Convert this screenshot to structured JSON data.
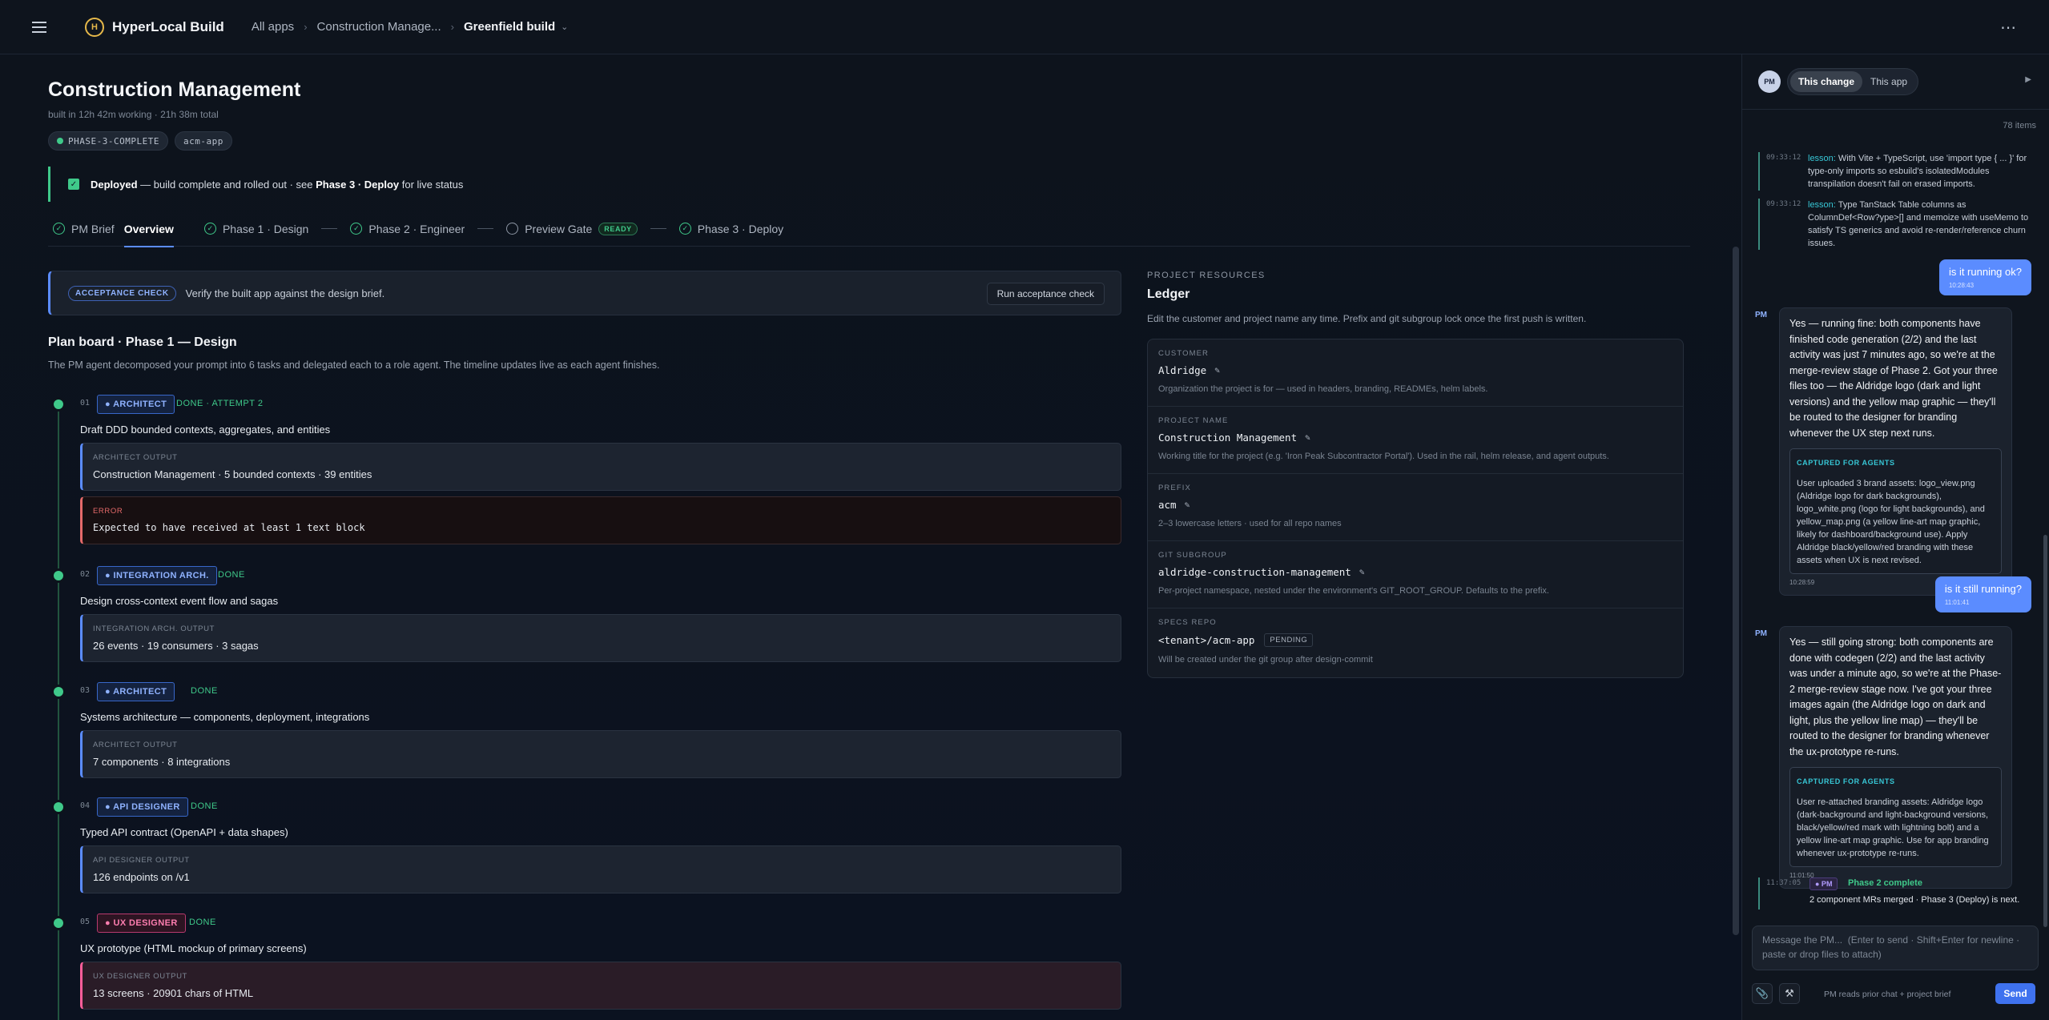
{
  "topbar": {
    "brand": "HyperLocal Build",
    "logo_letter": "H",
    "crumbs": [
      "All apps",
      "Construction Manage...",
      "Greenfield build"
    ],
    "caret": "⌄",
    "more": "⋯"
  },
  "header": {
    "title": "Construction Management",
    "subtitle": "built in 12h 42m working · 21h 38m total",
    "chips": [
      "PHASE-3-COMPLETE",
      "acm-app"
    ]
  },
  "deploy": {
    "strong": "Deployed",
    "text": " — build complete and rolled out · see ",
    "link": "Phase 3 · Deploy",
    "tail": " for live status"
  },
  "tabs": {
    "pm_brief": "PM Brief",
    "overview": "Overview",
    "phase1": "Phase 1 · Design",
    "phase2": "Phase 2 · Engineer",
    "preview": "Preview Gate",
    "ready": "READY",
    "phase3": "Phase 3 · Deploy"
  },
  "acceptance": {
    "tag": "ACCEPTANCE CHECK",
    "text": "Verify the built app against the design brief.",
    "button": "Run acceptance check"
  },
  "plan": {
    "title": "Plan board · Phase 1 — Design",
    "desc": "The PM agent decomposed your prompt into 6 tasks and delegated each to a role agent. The timeline updates live as each agent finishes.",
    "tasks": [
      {
        "num": "01",
        "role": "● ARCHITECT",
        "status": "DONE · ATTEMPT 2",
        "title": "Draft DDD bounded contexts, aggregates, and entities",
        "out_label": "ARCHITECT OUTPUT",
        "out_value": "Construction Management · 5 bounded contexts · 39 entities",
        "err_label": "ERROR",
        "err_value": "Expected to have received at least 1 text block"
      },
      {
        "num": "02",
        "role": "● INTEGRATION ARCH.",
        "status": "DONE",
        "title": "Design cross-context event flow and sagas",
        "out_label": "INTEGRATION ARCH. OUTPUT",
        "out_value": "26 events · 19 consumers · 3 sagas"
      },
      {
        "num": "03",
        "role": "● ARCHITECT",
        "status": "DONE",
        "title": "Systems architecture — components, deployment, integrations",
        "out_label": "ARCHITECT OUTPUT",
        "out_value": "7 components · 8 integrations"
      },
      {
        "num": "04",
        "role": "● API DESIGNER",
        "status": "DONE",
        "title": "Typed API contract (OpenAPI + data shapes)",
        "out_label": "API DESIGNER OUTPUT",
        "out_value": "126 endpoints on /v1"
      },
      {
        "num": "05",
        "role": "● UX DESIGNER",
        "status": "DONE",
        "title": "UX prototype (HTML mockup of primary screens)",
        "out_label": "UX DESIGNER OUTPUT",
        "out_value": "13 screens · 20901 chars of HTML"
      }
    ]
  },
  "resources": {
    "head": "PROJECT RESOURCES",
    "title": "Ledger",
    "desc": "Edit the customer and project name any time. Prefix and git subgroup lock once the first push is written.",
    "pencil": "✎",
    "rows": [
      {
        "label": "CUSTOMER",
        "value": "Aldridge",
        "help": "Organization the project is for — used in headers, branding, READMEs, helm labels."
      },
      {
        "label": "PROJECT NAME",
        "value": "Construction Management",
        "help": "Working title for the project (e.g. 'Iron Peak Subcontractor Portal'). Used in the rail, helm release, and agent outputs."
      },
      {
        "label": "PREFIX",
        "value": "acm",
        "help": "2–3 lowercase letters · used for all repo names"
      },
      {
        "label": "GIT SUBGROUP",
        "value": "aldridge-construction-management",
        "help": "Per-project namespace, nested under the environment's GIT_ROOT_GROUP. Defaults to the prefix."
      },
      {
        "label": "SPECS REPO",
        "value": "<tenant>/acm-app",
        "badge": "PENDING",
        "help": "Will be created under the git group after design-commit"
      }
    ]
  },
  "chat": {
    "avatar": "PM",
    "seg": [
      "This change",
      "This app"
    ],
    "collapse": "▶",
    "count": "78 items",
    "lessons": [
      {
        "time": "09:33:12",
        "key": "lesson:",
        "text": " With Vite + TypeScript, use 'import type { ... }' for type-only imports so esbuild's isolatedModules transpilation doesn't fail on erased imports."
      },
      {
        "time": "09:33:12",
        "key": "lesson:",
        "text": " Type TanStack Table columns as ColumnDef<Row?ype>[] and memoize with useMemo to satisfy TS generics and avoid re-render/reference churn issues."
      }
    ],
    "user1": {
      "text": "is it running ok?",
      "time": "10:28:43"
    },
    "pm1": {
      "tag": "PM",
      "text": "Yes — running fine: both components have finished code generation (2/2) and the last activity was just 7 minutes ago, so we're at the merge-review stage of Phase 2. Got your three files too — the Aldridge logo (dark and light versions) and the yellow map graphic — they'll be routed to the designer for branding whenever the UX step next runs.",
      "cap_head": "CAPTURED FOR AGENTS",
      "cap_body": "User uploaded 3 brand assets: logo_view.png (Aldridge logo for dark backgrounds), logo_white.png (logo for light backgrounds), and yellow_map.png (a yellow line-art map graphic, likely for dashboard/background use). Apply Aldridge black/yellow/red branding with these assets when UX is next revised.",
      "time": "10:28:59"
    },
    "user2": {
      "text": "is it still running?",
      "time": "11:01:41"
    },
    "pm2": {
      "tag": "PM",
      "text": "Yes — still going strong: both components are done with codegen (2/2) and the last activity was under a minute ago, so we're at the Phase-2 merge-review stage now. I've got your three images again (the Aldridge logo on dark and light, plus the yellow line map) — they'll be routed to the designer for branding whenever the ux-prototype re-runs.",
      "cap_head": "CAPTURED FOR AGENTS",
      "cap_body": "User re-attached branding assets: Aldridge logo (dark-background and light-background versions, black/yellow/red mark with lightning bolt) and a yellow line-art map graphic. Use for app branding whenever ux-prototype re-runs.",
      "time": "11:01:50"
    },
    "event": {
      "time": "11:37:05",
      "chip": "● PM",
      "title": "Phase 2 complete",
      "body": "2 component MRs merged · Phase 3 (Deploy) is next."
    },
    "composer_placeholder": "Message the PM...  (Enter to send · Shift+Enter for newline · paste or drop files to attach)",
    "attach_icon": "📎",
    "tool_icon": "⚒",
    "reads": "PM reads prior chat + project brief",
    "send": "Send"
  }
}
